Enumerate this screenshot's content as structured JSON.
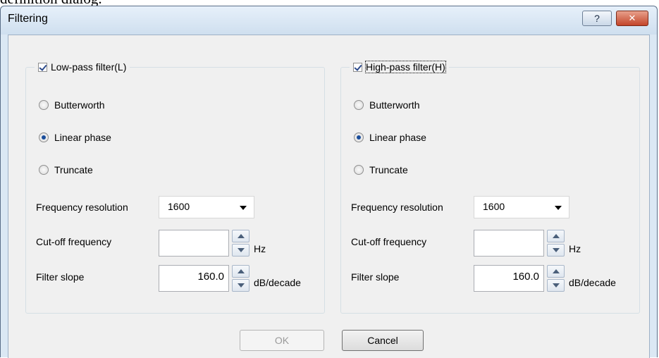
{
  "background_text": "definition dialog.",
  "dialog": {
    "title": "Filtering",
    "help_label": "?",
    "close_label": "✕"
  },
  "lowpass": {
    "label": "Low-pass filter(L)",
    "checked": true,
    "radios": [
      "Butterworth",
      "Linear phase",
      "Truncate"
    ],
    "selected_radio": "Linear phase",
    "freq_res_label": "Frequency resolution",
    "freq_res_value": "1600",
    "cutoff_label": "Cut-off frequency",
    "cutoff_value": "",
    "cutoff_unit": "Hz",
    "slope_label": "Filter slope",
    "slope_value": "160.0",
    "slope_unit": "dB/decade"
  },
  "highpass": {
    "label": "High-pass filter(H)",
    "checked": true,
    "radios": [
      "Butterworth",
      "Linear phase",
      "Truncate"
    ],
    "selected_radio": "Linear phase",
    "freq_res_label": "Frequency resolution",
    "freq_res_value": "1600",
    "cutoff_label": "Cut-off frequency",
    "cutoff_value": "",
    "cutoff_unit": "Hz",
    "slope_label": "Filter slope",
    "slope_value": "160.0",
    "slope_unit": "dB/decade"
  },
  "buttons": {
    "ok": "OK",
    "cancel": "Cancel"
  }
}
